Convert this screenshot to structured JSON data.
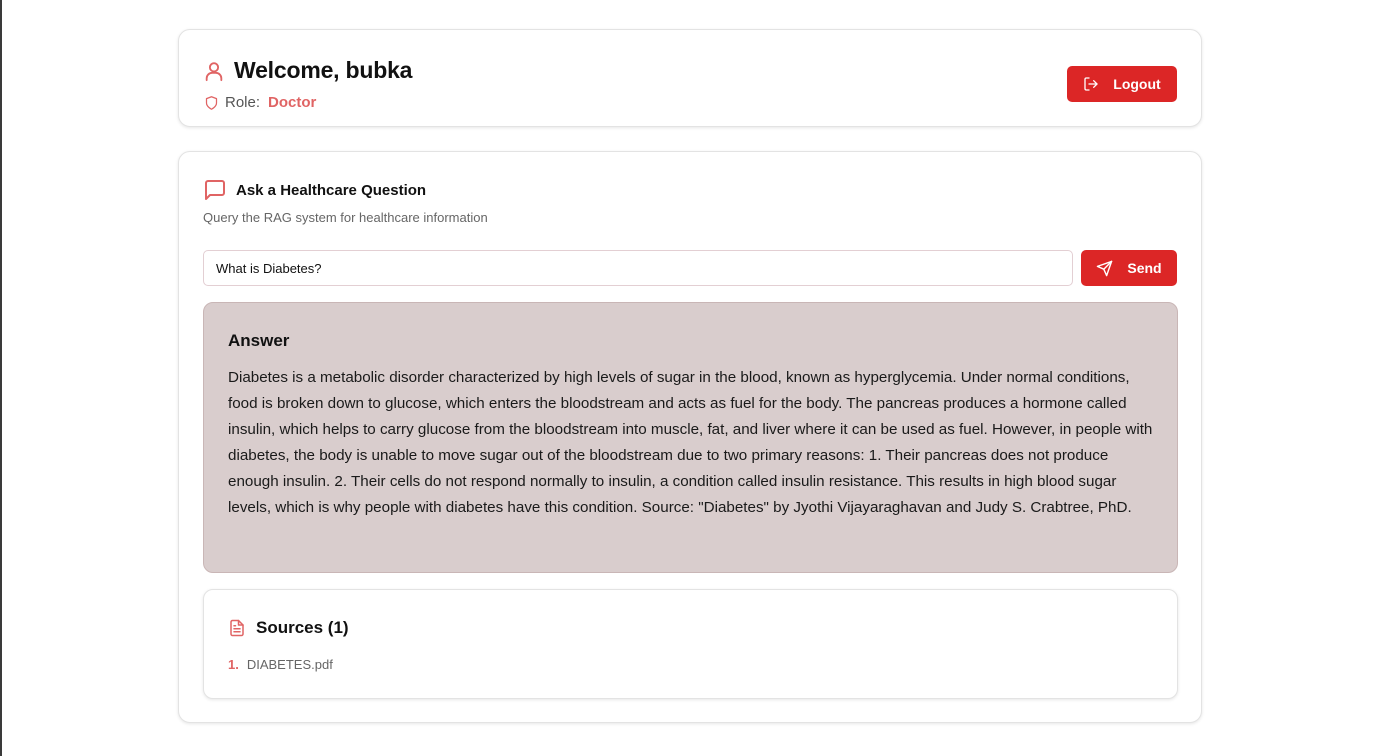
{
  "header": {
    "welcome": "Welcome, bubka",
    "role_label": "Role:",
    "role_value": "Doctor",
    "logout_label": "Logout",
    "icons": {
      "user": "user-icon",
      "role": "shield-icon",
      "logout": "log-out-icon"
    }
  },
  "query": {
    "title": "Ask a Healthcare Question",
    "subtitle": "Query the RAG system for healthcare information",
    "input_value": "What is Diabetes?",
    "send_label": "Send",
    "icons": {
      "title": "message-square-icon",
      "send": "send-icon"
    }
  },
  "answer": {
    "title": "Answer",
    "text": "Diabetes is a metabolic disorder characterized by high levels of sugar in the blood, known as hyperglycemia. Under normal conditions, food is broken down to glucose, which enters the bloodstream and acts as fuel for the body. The pancreas produces a hormone called insulin, which helps to carry glucose from the bloodstream into muscle, fat, and liver where it can be used as fuel. However, in people with diabetes, the body is unable to move sugar out of the bloodstream due to two primary reasons: 1. Their pancreas does not produce enough insulin. 2. Their cells do not respond normally to insulin, a condition called insulin resistance. This results in high blood sugar levels, which is why people with diabetes have this condition. Source: \"Diabetes\" by Jyothi Vijayaraghavan and Judy S. Crabtree, PhD."
  },
  "sources": {
    "title": "Sources (1)",
    "items": [
      {
        "number": "1.",
        "name": "DIABETES.pdf"
      }
    ],
    "icon": "file-text-icon"
  },
  "colors": {
    "accent": "#dc2626",
    "accent_light": "#e06464",
    "answer_bg": "#d9cdcd"
  }
}
